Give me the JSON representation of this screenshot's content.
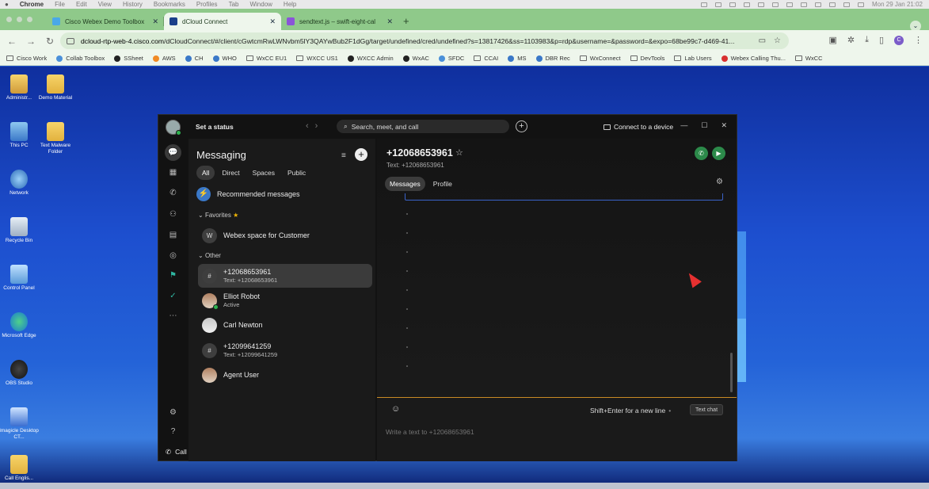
{
  "mac": {
    "app": "Chrome",
    "menus": [
      "File",
      "Edit",
      "View",
      "History",
      "Bookmarks",
      "Profiles",
      "Tab",
      "Window",
      "Help"
    ],
    "clock": "Mon 29 Jan 21:02"
  },
  "tabs": [
    {
      "title": "Cisco Webex Demo Toolbox",
      "color": "#4aa8e8"
    },
    {
      "title": "dCloud Connect",
      "color": "#1b3f8a"
    },
    {
      "title": "sendtext.js – swift-eight-cal",
      "color": "#8a55d8"
    }
  ],
  "url": {
    "host": "dcloud-rtp-web-4.cisco.com",
    "rest": "/dCloudConnect/#/client/cGwtcmRwLWNvbm5lY3QAYwBub2F1dGg/target/undefined/cred/undefined?s=13817426&ss=1103983&p=rdp&username=&password=&expo=68be99c7-d469-41..."
  },
  "bookmarks": [
    {
      "label": "Cisco Work",
      "icon": "folder-icon"
    },
    {
      "label": "Collab Toolbox",
      "icon": "cloud-icon"
    },
    {
      "label": "SSheet",
      "icon": "star-icon"
    },
    {
      "label": "AWS",
      "icon": "orange-dot-icon"
    },
    {
      "label": "CH",
      "icon": "webex-icon"
    },
    {
      "label": "WHO",
      "icon": "webex-icon"
    },
    {
      "label": "WxCC EU1",
      "icon": "folder-icon"
    },
    {
      "label": "WXCC US1",
      "icon": "folder-icon"
    },
    {
      "label": "WXCC Admin",
      "icon": "github-icon"
    },
    {
      "label": "WxAC",
      "icon": "github-icon"
    },
    {
      "label": "SFDC",
      "icon": "cloud-icon"
    },
    {
      "label": "CCAI",
      "icon": "folder-icon"
    },
    {
      "label": "MS",
      "icon": "webex-icon"
    },
    {
      "label": "DBR Rec",
      "icon": "dbr-icon"
    },
    {
      "label": "WxConnect",
      "icon": "folder-icon"
    },
    {
      "label": "DevTools",
      "icon": "folder-icon"
    },
    {
      "label": "Lab Users",
      "icon": "folder-icon"
    },
    {
      "label": "Webex Calling Thu...",
      "icon": "red-dot-icon"
    },
    {
      "label": "WxCC",
      "icon": "folder-icon"
    }
  ],
  "desktop": [
    {
      "label": "Administr...",
      "kind": "user"
    },
    {
      "label": "Demo Material",
      "kind": "folder"
    },
    {
      "label": "This PC",
      "kind": "pc"
    },
    {
      "label": "Text Malware Folder",
      "kind": "folder"
    },
    {
      "label": "Network",
      "kind": "net"
    },
    {
      "label": "Recycle Bin",
      "kind": "bin"
    },
    {
      "label": "Control Panel",
      "kind": "cp"
    },
    {
      "label": "Microsoft Edge",
      "kind": "edge"
    },
    {
      "label": "OBS Studio",
      "kind": "obs"
    },
    {
      "label": "Imagicle Desktop CT...",
      "kind": "app"
    },
    {
      "label": "Call Englis...",
      "kind": "folder"
    }
  ],
  "webex": {
    "status": "Set a status",
    "search": "Search, meet, and call",
    "connect": "Connect to a device",
    "call_settings": "Call settings",
    "messaging": {
      "title": "Messaging",
      "filters": [
        "All",
        "Direct",
        "Spaces",
        "Public"
      ],
      "recommended": "Recommended messages",
      "favorites_label": "Favorites",
      "favorites": [
        {
          "name": "Webex space for Customer",
          "initial": "W"
        }
      ],
      "other_label": "Other",
      "other": [
        {
          "name": "+12068653961",
          "sub": "Text: +12068653961",
          "initial": "#"
        },
        {
          "name": "Elliot Robot",
          "sub": "Active",
          "initial": ""
        },
        {
          "name": "Carl Newton",
          "sub": "",
          "initial": ""
        },
        {
          "name": "+12099641259",
          "sub": "Text: +12099641259",
          "initial": "#"
        },
        {
          "name": "Agent User",
          "sub": "",
          "initial": ""
        }
      ]
    },
    "conversation": {
      "title": "+12068653961",
      "subtitle": "Text: +12068653961",
      "tabs": [
        "Messages",
        "Profile"
      ],
      "hint": "Shift+Enter for a new line",
      "text_chat": "Text chat",
      "placeholder": "Write a text to +12068653961"
    }
  }
}
